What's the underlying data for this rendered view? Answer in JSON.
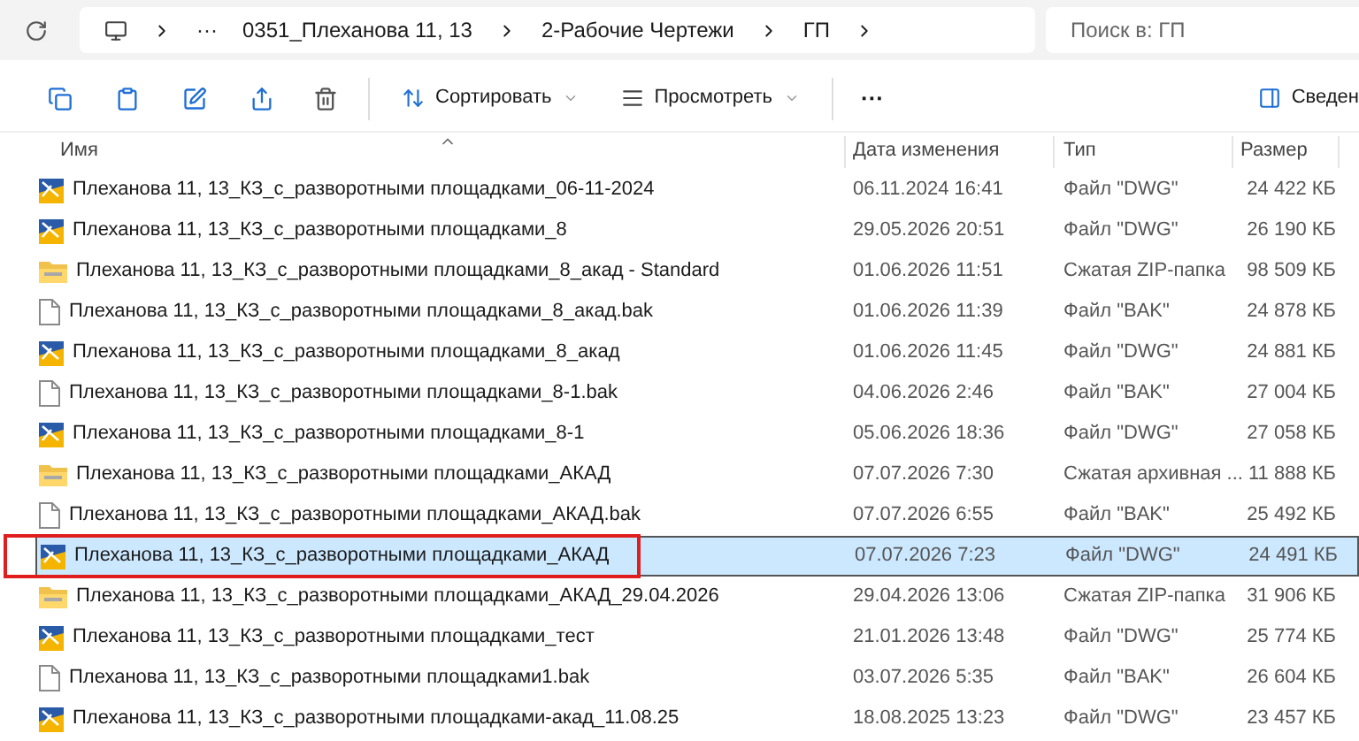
{
  "address_bar": {
    "ellipsis": "···",
    "crumbs": [
      "0351_Плеханова 11, 13",
      "2-Рабочие Чертежи",
      "ГП"
    ]
  },
  "search": {
    "placeholder": "Поиск в: ГП"
  },
  "toolbar": {
    "sort": "Сортировать",
    "view": "Просмотреть",
    "more": "···",
    "details": "Сведен"
  },
  "table": {
    "columns": [
      "Имя",
      "Дата изменения",
      "Тип",
      "Размер"
    ],
    "rows": [
      {
        "kind": "dwg",
        "name": "Плеханова 11, 13_КЗ_с_разворотными площадками_06-11-2024",
        "date": "06.11.2024 16:41",
        "type": "Файл \"DWG\"",
        "size": "24 422 КБ",
        "selected": false,
        "outlined": false
      },
      {
        "kind": "dwg",
        "name": "Плеханова 11, 13_КЗ_с_разворотными площадками_8",
        "date": "29.05.2026 20:51",
        "type": "Файл \"DWG\"",
        "size": "26 190 КБ",
        "selected": false,
        "outlined": false
      },
      {
        "kind": "zip",
        "name": "Плеханова 11, 13_КЗ_с_разворотными площадками_8_акад - Standard",
        "date": "01.06.2026 11:51",
        "type": "Сжатая ZIP-папка",
        "size": "98 509 КБ",
        "selected": false,
        "outlined": false
      },
      {
        "kind": "file",
        "name": "Плеханова 11, 13_КЗ_с_разворотными площадками_8_акад.bak",
        "date": "01.06.2026 11:39",
        "type": "Файл \"BAK\"",
        "size": "24 878 КБ",
        "selected": false,
        "outlined": false
      },
      {
        "kind": "dwg",
        "name": "Плеханова 11, 13_КЗ_с_разворотными площадками_8_акад",
        "date": "01.06.2026 11:45",
        "type": "Файл \"DWG\"",
        "size": "24 881 КБ",
        "selected": false,
        "outlined": false
      },
      {
        "kind": "file",
        "name": "Плеханова 11, 13_КЗ_с_разворотными площадками_8-1.bak",
        "date": "04.06.2026 2:46",
        "type": "Файл \"BAK\"",
        "size": "27 004 КБ",
        "selected": false,
        "outlined": false
      },
      {
        "kind": "dwg",
        "name": "Плеханова 11, 13_КЗ_с_разворотными площадками_8-1",
        "date": "05.06.2026 18:36",
        "type": "Файл \"DWG\"",
        "size": "27 058 КБ",
        "selected": false,
        "outlined": false
      },
      {
        "kind": "zip",
        "name": "Плеханова 11, 13_КЗ_с_разворотными площадками_АКАД",
        "date": "07.07.2026 7:30",
        "type": "Сжатая архивная ...",
        "size": "11 888 КБ",
        "selected": false,
        "outlined": false
      },
      {
        "kind": "file",
        "name": "Плеханова 11, 13_КЗ_с_разворотными площадками_АКАД.bak",
        "date": "07.07.2026 6:55",
        "type": "Файл \"BAK\"",
        "size": "25 492 КБ",
        "selected": false,
        "outlined": false
      },
      {
        "kind": "dwg",
        "name": "Плеханова 11, 13_КЗ_с_разворотными площадками_АКАД",
        "date": "07.07.2026 7:23",
        "type": "Файл \"DWG\"",
        "size": "24 491 КБ",
        "selected": true,
        "outlined": true
      },
      {
        "kind": "zip",
        "name": "Плеханова 11, 13_КЗ_с_разворотными площадками_АКАД_29.04.2026",
        "date": "29.04.2026 13:06",
        "type": "Сжатая ZIP-папка",
        "size": "31 906 КБ",
        "selected": false,
        "outlined": false
      },
      {
        "kind": "dwg",
        "name": "Плеханова 11, 13_КЗ_с_разворотными площадками_тест",
        "date": "21.01.2026 13:48",
        "type": "Файл \"DWG\"",
        "size": "25 774 КБ",
        "selected": false,
        "outlined": false
      },
      {
        "kind": "file",
        "name": "Плеханова 11, 13_КЗ_с_разворотными площадками1.bak",
        "date": "03.07.2026 5:35",
        "type": "Файл \"BAK\"",
        "size": "26 604 КБ",
        "selected": false,
        "outlined": false
      },
      {
        "kind": "dwg",
        "name": "Плеханова 11, 13_КЗ_с_разворотными площадками-акад_11.08.25",
        "date": "18.08.2025 13:23",
        "type": "Файл \"DWG\"",
        "size": "23 457 КБ",
        "selected": false,
        "outlined": false
      }
    ]
  }
}
